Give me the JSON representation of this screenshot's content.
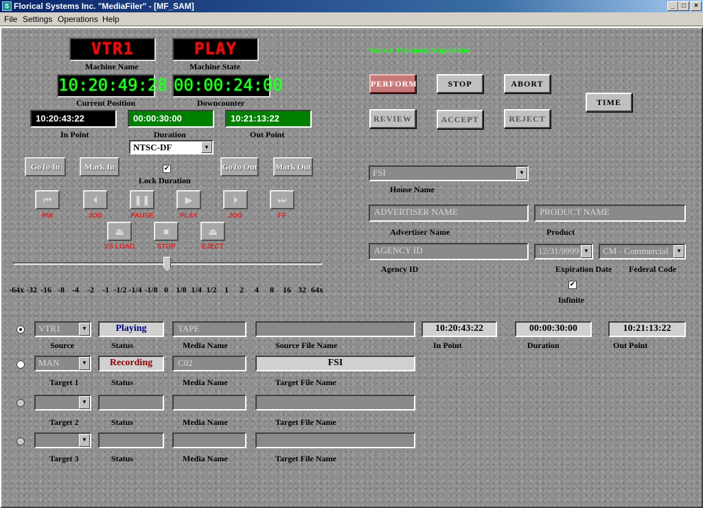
{
  "window": {
    "title": "Florical Systems Inc. \"MediaFiler\" - [MF_SAM]",
    "controls": [
      "_",
      "□",
      "×"
    ]
  },
  "menu": [
    "File",
    "Settings",
    "Operations",
    "Help"
  ],
  "deck": {
    "machine_name": "VTR1",
    "machine_name_label": "Machine Name",
    "machine_state": "PLAY",
    "machine_state_label": "Machine State",
    "current_position": "10:20:49:28",
    "current_position_label": "Current Position",
    "downcounter": "00:00:24:00",
    "downcounter_label": "Downcounter",
    "in_point": "10:20:43:22",
    "in_point_label": "In Point",
    "duration": "00:00:30:00",
    "duration_label": "Duration",
    "out_point": "10:21:13:22",
    "out_point_label": "Out Point",
    "timecode_format": "NTSC-DF",
    "goto_in": "GoTo In",
    "mark_in": "Mark In",
    "goto_out": "GoTo Out",
    "mark_out": "Mark Out",
    "lock_duration": "Lock Duration",
    "lock_checked": "✔"
  },
  "transport": {
    "row1": [
      {
        "icon": "rewind-icon",
        "glyph": "⏮",
        "label": "RW"
      },
      {
        "icon": "jog-back-icon",
        "glyph": "⏴",
        "label": "JOG"
      },
      {
        "icon": "pause-icon",
        "glyph": "❚❚",
        "label": "PAUSE"
      },
      {
        "icon": "play-icon",
        "glyph": "▶",
        "label": "PLAY"
      },
      {
        "icon": "jog-forward-icon",
        "glyph": "⏵",
        "label": "JOG"
      },
      {
        "icon": "fast-forward-icon",
        "glyph": "⏭",
        "label": "FF"
      }
    ],
    "row2": [
      {
        "icon": "load-icon",
        "glyph": "⏏",
        "label": "VS LOAD"
      },
      {
        "icon": "stop-icon",
        "glyph": "■",
        "label": "STOP"
      },
      {
        "icon": "eject-icon",
        "glyph": "⏏",
        "label": "EJECT"
      }
    ],
    "shuttle_ticks": [
      "-64x",
      "-32",
      "-16",
      "-8",
      "-4",
      "-2",
      "-1",
      "-1/2",
      "-1/4",
      "-1/8",
      "0",
      "1/8",
      "1/4",
      "1/2",
      "1",
      "2",
      "4",
      "8",
      "16",
      "32",
      "64x"
    ],
    "shuttle_position": "0"
  },
  "operation": {
    "title": "Source Trimmed Acquisition",
    "perform": "PERFORM",
    "stop": "STOP",
    "abort": "ABORT",
    "review": "REVIEW",
    "accept": "ACCEPT",
    "reject": "REJECT",
    "time": "TIME"
  },
  "metadata": {
    "house_name": "FSI",
    "house_name_label": "House Name",
    "advertiser": "ADVERTISER NAME",
    "advertiser_label": "Advertiser Name",
    "product": "PRODUCT NAME",
    "product_label": "Product",
    "agency": "AGENCY ID",
    "agency_label": "Agency ID",
    "expiration": "12/31/9999",
    "expiration_label": "Expiration Date",
    "federal_code": "CM - Commercial",
    "federal_code_label": "Federal Code",
    "infinite_label": "Infinite",
    "infinite_checked": "✔"
  },
  "routing": {
    "source": {
      "device": "VTR1",
      "device_label": "Source",
      "status": "Playing",
      "status_label": "Status",
      "media": "TAPE",
      "media_label": "Media Name",
      "file": "",
      "file_label": "Source File Name",
      "in_point": "10:20:43:22",
      "in_label": "In Point",
      "duration": "00:00:30:00",
      "duration_label": "Duration",
      "out_point": "10:21:13:22",
      "out_label": "Out Point"
    },
    "target1": {
      "device": "MAN",
      "device_label": "Target 1",
      "status": "Recording",
      "status_label": "Status",
      "media": "C02",
      "media_label": "Media Name",
      "file": "FSI",
      "file_label": "Target File Name"
    },
    "target2": {
      "device": "",
      "device_label": "Target 2",
      "status": "",
      "status_label": "Status",
      "media": "",
      "media_label": "Media Name",
      "file": "",
      "file_label": "Target File Name"
    },
    "target3": {
      "device": "",
      "device_label": "Target 3",
      "status": "",
      "status_label": "Status",
      "media": "",
      "media_label": "Media Name",
      "file": "",
      "file_label": "Target File Name"
    }
  }
}
